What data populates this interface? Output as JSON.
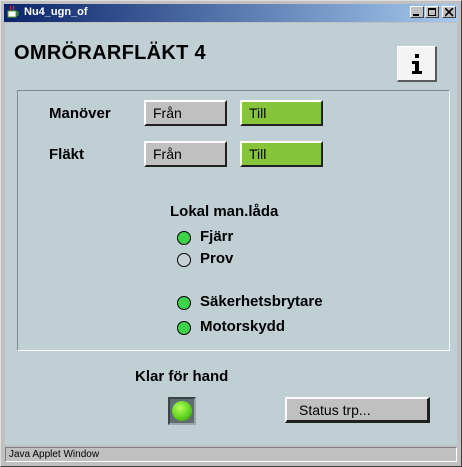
{
  "window": {
    "title": "Nu4_ugn_of",
    "statusbar_text": "Java Applet Window"
  },
  "header": {
    "title": "OMRÖRARFLÄKT 4",
    "info_icon": "info-icon"
  },
  "controls": {
    "rows": [
      {
        "label": "Manöver",
        "off_label": "Från",
        "on_label": "Till"
      },
      {
        "label": "Fläkt",
        "off_label": "Från",
        "on_label": "Till"
      }
    ]
  },
  "local_box": {
    "title": "Lokal man.låda",
    "indicators": [
      {
        "label": "Fjärr",
        "state": "on",
        "color": "#3ed14a"
      },
      {
        "label": "Prov",
        "state": "off",
        "color": "#c8d2d6"
      }
    ]
  },
  "safety": {
    "indicators": [
      {
        "label": "Säkerhetsbrytare",
        "state": "on",
        "color": "#3ed14a"
      },
      {
        "label": "Motorskydd",
        "state": "on",
        "color": "#3ed14a"
      }
    ]
  },
  "ready": {
    "label": "Klar för hand",
    "state": "on"
  },
  "status_button": {
    "label": "Status trp..."
  },
  "colors": {
    "background": "#bfcfd3",
    "active_button": "#86c43a",
    "indicator_on": "#3ed14a",
    "titlebar": "#0a246a"
  }
}
